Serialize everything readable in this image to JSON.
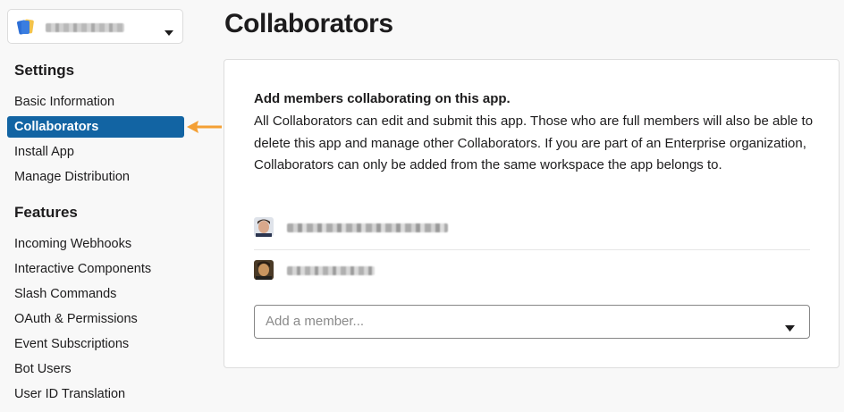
{
  "sidebar": {
    "app_name": "",
    "settings_title": "Settings",
    "settings_items": [
      {
        "label": "Basic Information"
      },
      {
        "label": "Collaborators",
        "active": true
      },
      {
        "label": "Install App"
      },
      {
        "label": "Manage Distribution"
      }
    ],
    "features_title": "Features",
    "features_items": [
      {
        "label": "Incoming Webhooks"
      },
      {
        "label": "Interactive Components"
      },
      {
        "label": "Slash Commands"
      },
      {
        "label": "OAuth & Permissions"
      },
      {
        "label": "Event Subscriptions"
      },
      {
        "label": "Bot Users"
      },
      {
        "label": "User ID Translation"
      }
    ]
  },
  "main": {
    "title": "Collaborators",
    "heading": "Add members collaborating on this app.",
    "description": "All Collaborators can edit and submit this app. Those who are full members will also be able to delete this app and manage other Collaborators. If you are part of an Enterprise organization, Collaborators can only be added from the same workspace the app belongs to.",
    "collaborators": [
      {
        "name": ""
      },
      {
        "name": ""
      }
    ],
    "add_member_placeholder": "Add a member..."
  },
  "colors": {
    "active_nav": "#1264a3",
    "annotation_arrow": "#f4a035"
  }
}
